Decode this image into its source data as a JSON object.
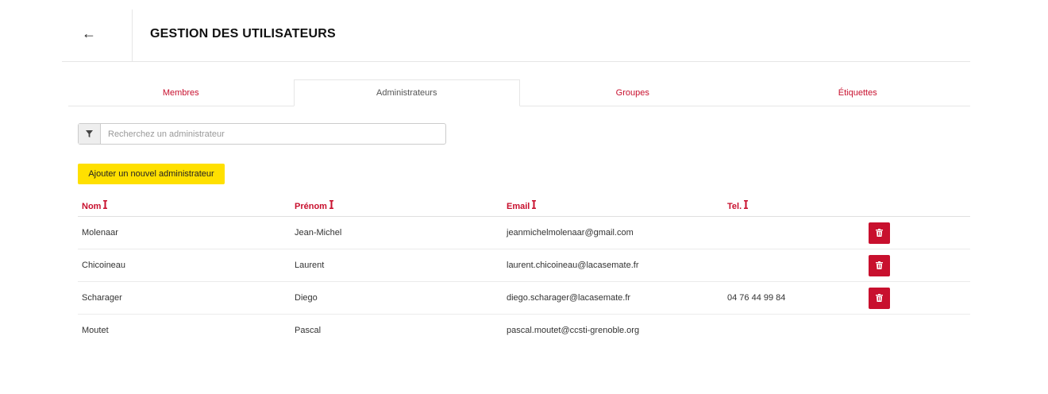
{
  "header": {
    "back_icon": "arrow-left-icon",
    "back_glyph": "←",
    "title": "GESTION DES UTILISATEURS"
  },
  "tabs": [
    {
      "label": "Membres",
      "active": false
    },
    {
      "label": "Administrateurs",
      "active": true
    },
    {
      "label": "Groupes",
      "active": false
    },
    {
      "label": "Étiquettes",
      "active": false
    }
  ],
  "search": {
    "placeholder": "Recherchez un administrateur",
    "value": "",
    "icon": "filter-icon"
  },
  "add_button": {
    "label": "Ajouter un nouvel administrateur"
  },
  "table": {
    "headers": {
      "nom": "Nom",
      "prenom": "Prénom",
      "email": "Email",
      "tel": "Tel."
    },
    "rows": [
      {
        "nom": "Molenaar",
        "prenom": "Jean-Michel",
        "email": "jeanmichelmolenaar@gmail.com",
        "tel": "",
        "deletable": true
      },
      {
        "nom": "Chicoineau",
        "prenom": "Laurent",
        "email": "laurent.chicoineau@lacasemate.fr",
        "tel": "",
        "deletable": true
      },
      {
        "nom": "Scharager",
        "prenom": "Diego",
        "email": "diego.scharager@lacasemate.fr",
        "tel": "04 76 44 99 84",
        "deletable": true
      },
      {
        "nom": "Moutet",
        "prenom": "Pascal",
        "email": "pascal.moutet@ccsti-grenoble.org",
        "tel": "",
        "deletable": false
      }
    ]
  },
  "colors": {
    "accent": "#c8102e",
    "button_yellow": "#ffe000"
  }
}
